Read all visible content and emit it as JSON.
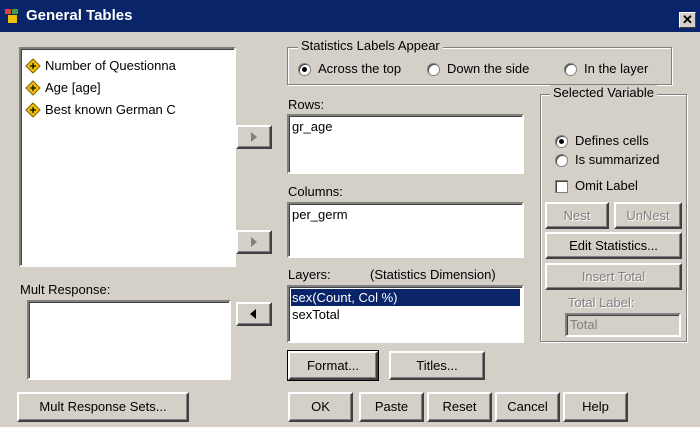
{
  "window": {
    "title": "General Tables",
    "close_glyph": "✕"
  },
  "variables": [
    {
      "label": "Number of Questionna",
      "icon": "ruler-scale-icon"
    },
    {
      "label": "Age [age]",
      "icon": "ruler-scale-icon"
    },
    {
      "label": "Best known German C",
      "icon": "ruler-scale-icon"
    }
  ],
  "mult_response": {
    "label": "Mult Response:",
    "button": "Mult Response Sets..."
  },
  "stats_labels": {
    "title": "Statistics Labels Appear",
    "options": [
      "Across the top",
      "Down the side",
      "In the layer"
    ],
    "selected": "Across the top"
  },
  "rows": {
    "label": "Rows:",
    "items": [
      "gr_age"
    ]
  },
  "columns": {
    "label": "Columns:",
    "items": [
      "per_germ"
    ]
  },
  "layers": {
    "label": "Layers:",
    "dimension_label": "(Statistics Dimension)",
    "items": [
      "sex(Count, Col %)",
      "sexTotal"
    ],
    "selected": "sex(Count, Col %)"
  },
  "selected_variable": {
    "title": "Selected Variable",
    "options": [
      "Defines cells",
      "Is summarized"
    ],
    "selected": "Defines cells",
    "omit_label": "Omit Label",
    "nest": "Nest",
    "unnest": "UnNest",
    "edit_statistics": "Edit Statistics...",
    "insert_total": "Insert Total",
    "total_label": "Total Label:",
    "total_value": "Total"
  },
  "buttons": {
    "format": "Format...",
    "titles": "Titles...",
    "ok": "OK",
    "paste": "Paste",
    "reset": "Reset",
    "cancel": "Cancel",
    "help": "Help"
  },
  "colors": {
    "titlebar": "#0a246a",
    "face": "#d4d0c8",
    "selection": "#0a246a",
    "icon_fill": "#f0c000"
  }
}
